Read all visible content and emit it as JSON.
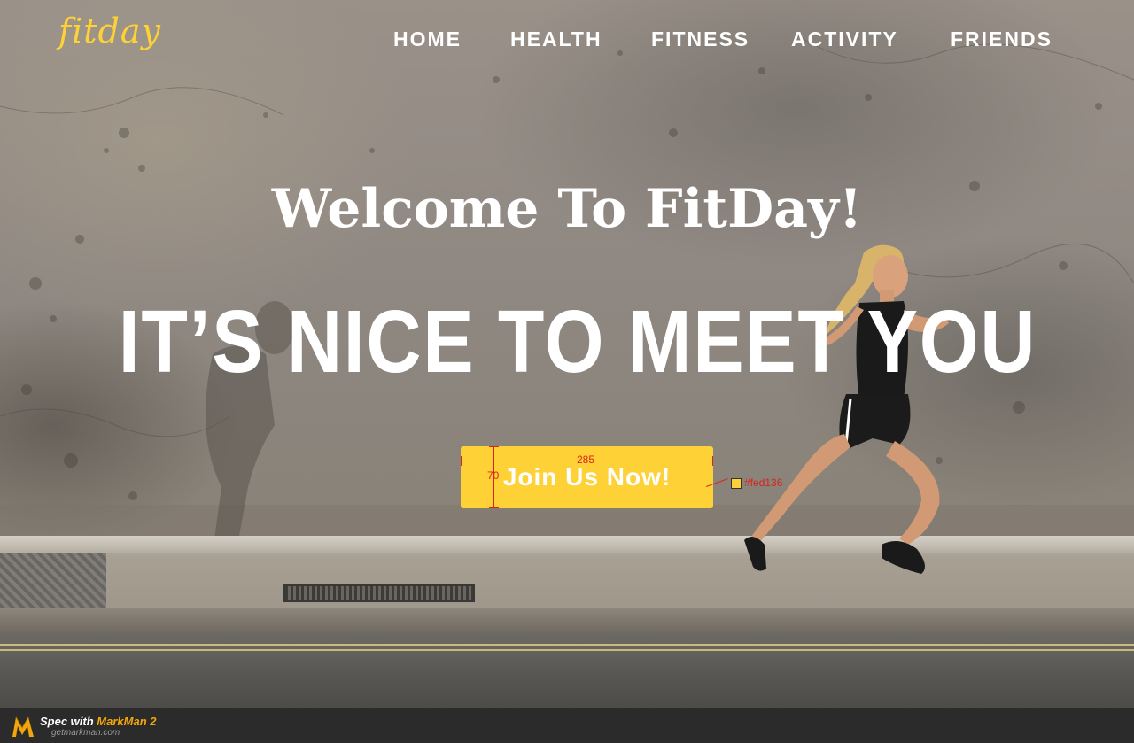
{
  "brand": {
    "logo_text": "fitday",
    "accent_color": "#fed136"
  },
  "nav": {
    "items": [
      {
        "label": "HOME"
      },
      {
        "label": "HEALTH"
      },
      {
        "label": "FITNESS"
      },
      {
        "label": "ACTIVITY"
      },
      {
        "label": "FRIENDS"
      }
    ]
  },
  "hero": {
    "welcome": "Welcome To FitDay",
    "welcome_mark": "!",
    "headline": "IT’S NICE TO MEET YOU",
    "cta_label": "Join Us Now!"
  },
  "spec": {
    "width_label": "285",
    "height_label": "70",
    "color_label": "#fed136"
  },
  "footer": {
    "spec_prefix": "Spec with ",
    "spec_brand": "MarkMan 2",
    "url": "getmarkman.com"
  }
}
